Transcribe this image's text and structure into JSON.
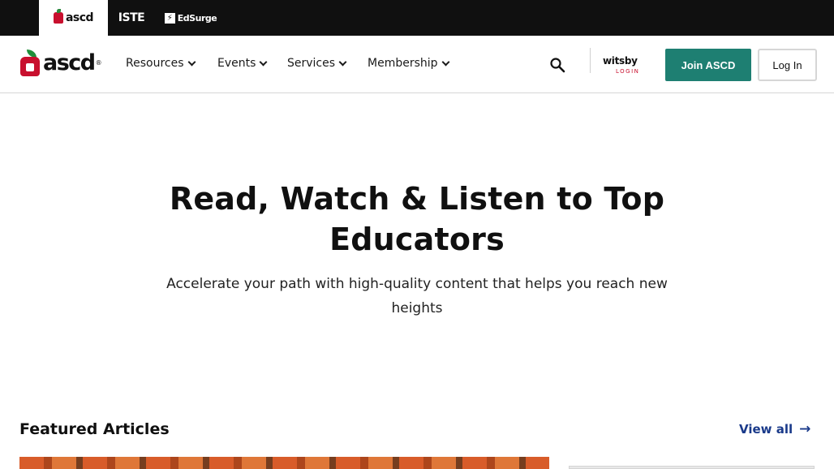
{
  "brandbar": {
    "tabs": [
      {
        "label": "ascd",
        "active": true
      },
      {
        "label": "ISTE",
        "active": false
      },
      {
        "label": "EdSurge",
        "active": false
      }
    ]
  },
  "nav": {
    "logo": "ascd",
    "logo_reg": "®",
    "items": [
      {
        "label": "Resources"
      },
      {
        "label": "Events"
      },
      {
        "label": "Services"
      },
      {
        "label": "Membership"
      }
    ],
    "witsby": {
      "word": "witsby",
      "sub": "LOGIN"
    },
    "join_label": "Join ASCD",
    "login_label": "Log In"
  },
  "hero": {
    "title": "Read, Watch & Listen to Top Educators",
    "subtitle": "Accelerate your path with high-quality content that helps you reach new heights"
  },
  "featured": {
    "title": "Featured Articles",
    "view_all": "View all",
    "arrow": "→"
  },
  "colors": {
    "topbar": "#101010",
    "brand_red": "#c8102e",
    "brand_green": "#1f8f3a",
    "join_button": "#1e7f72",
    "link_blue": "#1a3a8a"
  },
  "icons": {
    "search": "search-icon",
    "chevron": "chevron-down-icon",
    "arrow": "arrow-right-icon"
  }
}
